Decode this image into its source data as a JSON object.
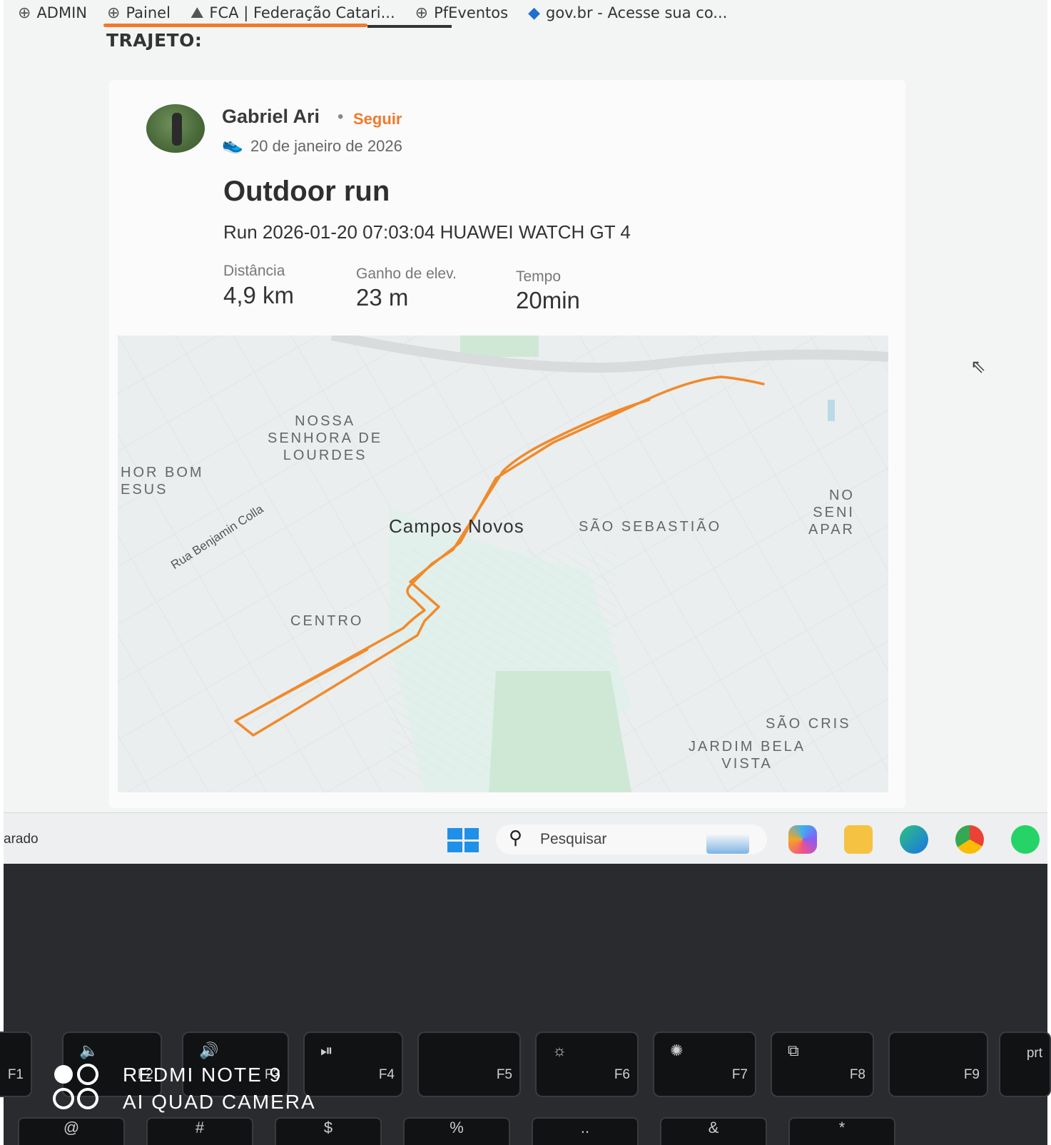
{
  "bookmarks": [
    {
      "label": "ADMIN"
    },
    {
      "label": "Painel"
    },
    {
      "label": "FCA | Federação Catari..."
    },
    {
      "label": "PfEventos"
    },
    {
      "label": "gov.br - Acesse sua co..."
    }
  ],
  "section_title": "TRAJETO:",
  "activity": {
    "author": "Gabriel Ari",
    "follow_label": "Seguir",
    "date": "20 de janeiro de 2026",
    "title": "Outdoor run",
    "subtitle": "Run 2026-01-20 07:03:04 HUAWEI WATCH GT 4",
    "stats": [
      {
        "label": "Distância",
        "value": "4,9 km"
      },
      {
        "label": "Ganho de elev.",
        "value": "23 m"
      },
      {
        "label": "Tempo",
        "value": "20min"
      }
    ]
  },
  "map": {
    "route_color": "#f08a2c",
    "labels": {
      "nossa_senhora": "NOSSA\nSENHORA DE\nLOURDES",
      "bom_jesus": "HOR BOM\nESUS",
      "sao_sebastiao": "SÃO SEBASTIÃO",
      "centro": "CENTRO",
      "no_seni_apar": "NO\nSENI\nAPAR",
      "sao_cris": "SÃO CRIS",
      "jardim": "JARDIM BELA\nVISTA",
      "city": "Campos Novos",
      "street": "Rua Benjamin Colla"
    }
  },
  "taskbar": {
    "left_text": "arado",
    "search_placeholder": "Pesquisar"
  },
  "keyboard": {
    "fkeys": [
      "F1",
      "F2",
      "F3",
      "F4",
      "F5",
      "F6",
      "F7",
      "F8",
      "F9",
      "prt"
    ],
    "bottom_keys": [
      "@",
      "#",
      "$",
      "%",
      "..",
      "&",
      "*"
    ]
  },
  "watermark": {
    "line1": "REDMI NOTE 9",
    "line2": "AI QUAD CAMERA"
  },
  "colors": {
    "accent": "#f07a2a",
    "windows_blue": "#1e90e8"
  }
}
